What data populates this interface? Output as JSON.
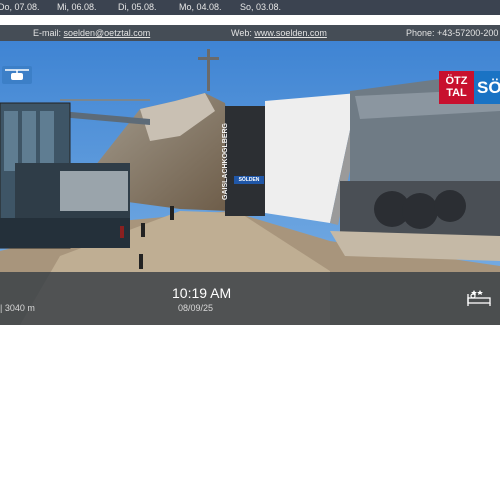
{
  "history_bar": {
    "days": [
      "Do, 07.08.",
      "Mi, 06.08.",
      "Di, 05.08.",
      "Mo, 04.08.",
      "So, 03.08."
    ]
  },
  "info_bar": {
    "email_label": "E-mail: ",
    "email": "soelden@oetztal.com",
    "web_label": "Web: ",
    "web": "www.soelden.com",
    "phone": "Phone: +43-57200-200"
  },
  "webcam": {
    "time": "10:19 AM",
    "date": "08/09/25",
    "altitude": "| 3040 m",
    "station_name": "GAISLACHKOGLBERG",
    "station_sign": "SÖLDEN",
    "brand_red": "ÖTZ TAL",
    "brand_blue": "SÖ"
  },
  "icons": {
    "ski": "ski-lift-icon",
    "bed": "bed-icon"
  },
  "colors": {
    "topbar": "#3b4350",
    "infobar": "#454d56",
    "sky": "#4f8fd6",
    "brand_red": "#c8102e",
    "brand_blue": "#1a73c4"
  }
}
